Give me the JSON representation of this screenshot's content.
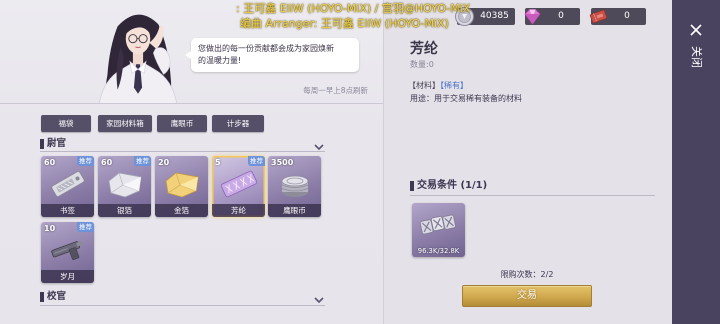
{
  "overlay_credits": {
    "line1": ": 王可鑫 EliW (HOYO-MiX) / 宫羽@HOYO-MiX",
    "line2": "编曲 Arranger: 王可鑫 EliW (HOYO-MiX)"
  },
  "currencies": [
    {
      "icon": "silver-coin-icon",
      "value": "40385"
    },
    {
      "icon": "pink-diamond-icon",
      "value": "0"
    },
    {
      "icon": "red-ticket-icon",
      "value": "0"
    }
  ],
  "close_panel": {
    "icon": "close-icon",
    "label": "关闭"
  },
  "npc": {
    "dialogue_lines": [
      "您做出的每一份贡献都会成为家园焕新",
      "的温暖力量!"
    ]
  },
  "refresh_note": "每周一早上8点刷新",
  "tabs": [
    {
      "label": "福袋"
    },
    {
      "label": "家园材料箱"
    },
    {
      "label": "鹰眼币"
    },
    {
      "label": "计步器"
    }
  ],
  "sections": [
    {
      "title": "尉官",
      "items": [
        {
          "name": "书签",
          "count": "60",
          "badge": "推荐",
          "icon": "bookmark-icon",
          "selected": false
        },
        {
          "name": "银箔",
          "count": "60",
          "badge": "推荐",
          "icon": "silver-foil-icon",
          "selected": false
        },
        {
          "name": "金箔",
          "count": "20",
          "icon": "gold-foil-icon",
          "selected": false
        },
        {
          "name": "芳纶",
          "count": "5",
          "badge": "推荐",
          "icon": "aramid-icon",
          "selected": true
        },
        {
          "name": "鹰眼币",
          "count": "3500",
          "icon": "hawkeye-coin-icon",
          "selected": false
        },
        {
          "name": "岁月",
          "count": "10",
          "badge": "推荐",
          "icon": "years-icon",
          "selected": false
        }
      ]
    },
    {
      "title": "校官"
    }
  ],
  "detail": {
    "name": "芳纶",
    "quantity": "数量:0",
    "tags": [
      {
        "text": "【材料】",
        "color": "#4a4358"
      },
      {
        "text": "【稀有】",
        "color": "#4c73c9"
      }
    ],
    "usage": "用途：用于交易稀有装备的材料",
    "trade_conditions_title": "交易条件 (1/1)",
    "cost": {
      "icon": "aramid-bundle-icon",
      "amount": "96.3K/32.8K"
    },
    "purchase_limit": "限购次数：2/2",
    "trade_button_label": "交易"
  },
  "colors": {
    "background": "#e6e4ea",
    "tab_bg": "#564f68",
    "card_badge": "#6e93d8",
    "selected_outline": "#f3c95c",
    "trade_button": "#cfa84e",
    "credit_yellow": "#f2d64b",
    "close_strip": "#4a4360"
  }
}
